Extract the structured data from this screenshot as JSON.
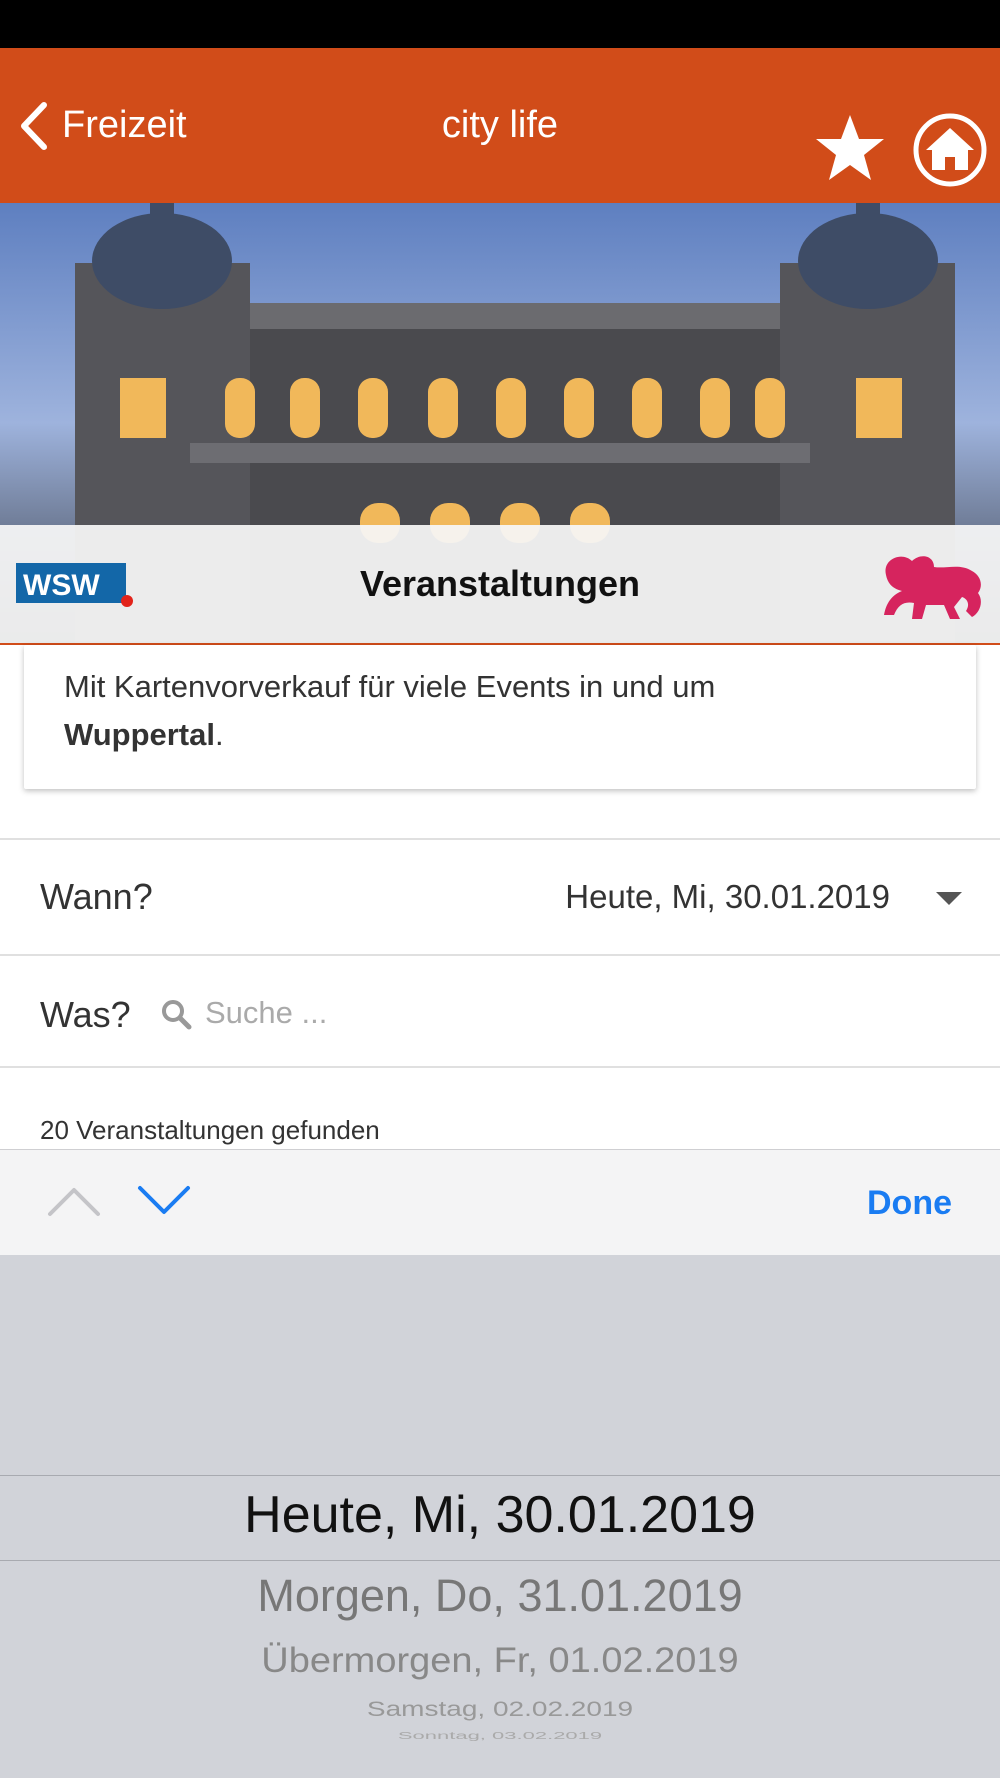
{
  "nav": {
    "back_label": "Freizeit",
    "title": "city life"
  },
  "subheader": {
    "logo_text": "WSW",
    "title": "Veranstaltungen"
  },
  "intro": {
    "line1": "Mit Kartenvorverkauf für viele Events in und um",
    "city": "Wuppertal",
    "trailing": "."
  },
  "filters": {
    "when_label": "Wann?",
    "when_value": "Heute, Mi, 30.01.2019",
    "what_label": "Was?",
    "search_placeholder": "Suche ..."
  },
  "results": {
    "count_text": "20 Veranstaltungen gefunden"
  },
  "toolbar": {
    "done_label": "Done"
  },
  "picker": {
    "selected": "Heute, Mi, 30.01.2019",
    "options": [
      "Morgen, Do, 31.01.2019",
      "Übermorgen, Fr, 01.02.2019",
      "Samstag, 02.02.2019",
      "Sonntag, 03.02.2019"
    ]
  },
  "colors": {
    "brand": "#d14c19",
    "accent": "#1a7cf2",
    "picker_bg": "#d1d3d9",
    "lion": "#d6245e"
  },
  "icons": [
    "back-chevron-icon",
    "star-icon",
    "home-icon",
    "search-icon",
    "chevron-up-icon",
    "chevron-down-icon",
    "caret-down-icon"
  ]
}
